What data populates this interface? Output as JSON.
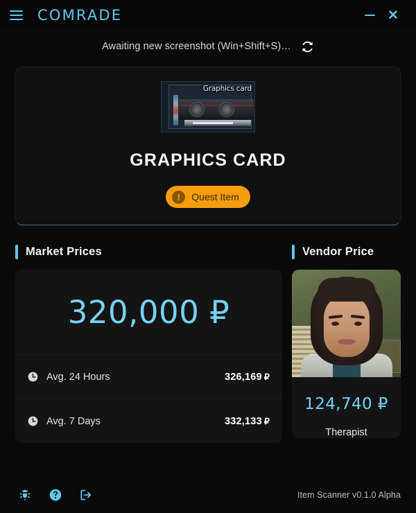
{
  "titlebar": {
    "menu_icon": "hamburger-icon",
    "brand": "COMRADE",
    "minimize_label": "—",
    "close_label": "✕"
  },
  "status": {
    "text": "Awaiting new screenshot (Win+Shift+S)…",
    "refresh_icon": "refresh-icon"
  },
  "item": {
    "thumbnail_label": "Graphics card",
    "title": "GRAPHICS CARD",
    "badge": {
      "label": "Quest Item",
      "icon": "exclamation-icon",
      "color": "#f59d0e"
    }
  },
  "market": {
    "section_title": "Market Prices",
    "flea_price": "320,000 ₽",
    "rows": [
      {
        "icon": "clock-icon",
        "label": "Avg. 24 Hours",
        "value": "326,169",
        "currency": "₽"
      },
      {
        "icon": "clock-icon",
        "label": "Avg. 7 Days",
        "value": "332,133",
        "currency": "₽"
      }
    ]
  },
  "vendor": {
    "section_title": "Vendor Price",
    "price": "124,740 ₽",
    "name": "Therapist",
    "portrait_alt": "therapist-portrait"
  },
  "footer": {
    "icons": [
      {
        "name": "bug-icon",
        "title": "Report bug"
      },
      {
        "name": "help-icon",
        "title": "Help"
      },
      {
        "name": "exit-icon",
        "title": "Exit"
      }
    ],
    "version": "Item Scanner v0.1.0 Alpha"
  },
  "theme": {
    "accent": "#63c5ea",
    "price_blue": "#76d2f4",
    "quest_orange": "#f59d0e",
    "background": "#0a0a0a",
    "panel": "#141414"
  }
}
